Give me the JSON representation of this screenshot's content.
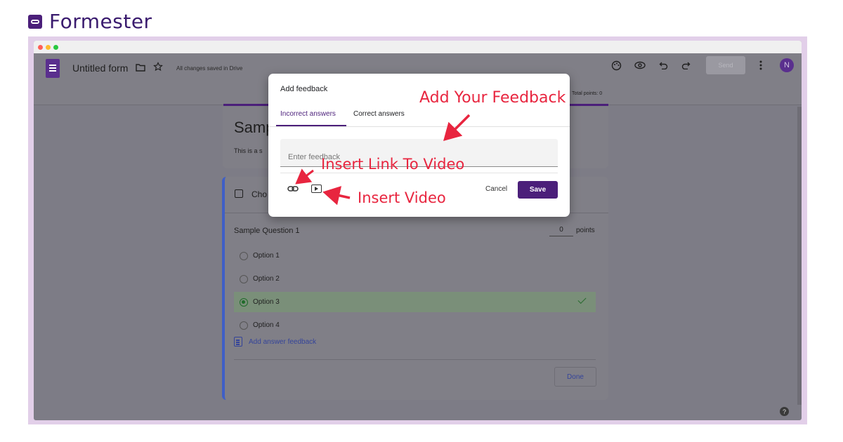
{
  "brand": {
    "name": "Formester"
  },
  "window": {
    "traffic_lights": [
      "#ff5f57",
      "#febc2e",
      "#28c840"
    ]
  },
  "appbar": {
    "form_title": "Untitled form",
    "saved_status": "All changes saved in Drive",
    "send_label": "Send",
    "avatar_initial": "N",
    "total_points": "Total points: 0",
    "icons": [
      "folder-icon",
      "star-icon",
      "palette-icon",
      "preview-eye-icon",
      "undo-icon",
      "redo-icon",
      "more-vert-icon"
    ]
  },
  "form": {
    "title": "Samp",
    "description": "This is a s"
  },
  "question": {
    "type_label_partial": "Cho",
    "text": "Sample Question 1",
    "points_value": "0",
    "points_label": "points",
    "options": [
      {
        "label": "Option 1",
        "correct": false
      },
      {
        "label": "Option 2",
        "correct": false
      },
      {
        "label": "Option 3",
        "correct": true
      },
      {
        "label": "Option 4",
        "correct": false
      }
    ],
    "add_feedback_label": "Add answer feedback",
    "done_label": "Done"
  },
  "dialog": {
    "title": "Add feedback",
    "tabs": [
      {
        "label": "Incorrect answers",
        "active": true
      },
      {
        "label": "Correct answers",
        "active": false
      }
    ],
    "feedback_placeholder": "Enter feedback",
    "cancel_label": "Cancel",
    "save_label": "Save"
  },
  "annotations": {
    "add_feedback": "Add Your Feedback",
    "insert_link": "Insert Link To Video",
    "insert_video": "Insert Video",
    "color": "#e8253f"
  },
  "help_label": "?",
  "colors": {
    "brand_purple": "#4b1f7a",
    "accent_blue": "#3f5fc6",
    "annotation_red": "#e8253f"
  }
}
